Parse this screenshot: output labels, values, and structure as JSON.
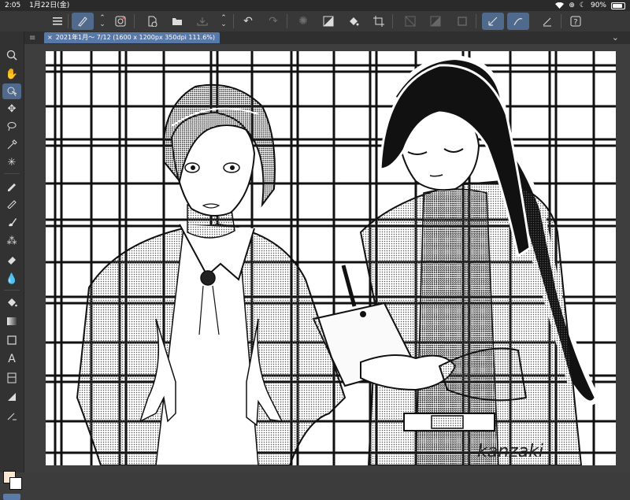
{
  "status_bar": {
    "time": "2:05",
    "date": "1月22日(金)",
    "battery": "90%",
    "battery_level": 0.9
  },
  "command_bar": {
    "menu_icon": "hamburger-menu-icon",
    "tools": [
      "drawing-select-icon",
      "swap-icon",
      "capture-icon",
      "new-canvas-icon",
      "open-folder-icon",
      "save-icon",
      "undo-icon",
      "redo-icon",
      "loading-spinner-icon",
      "fill-icon",
      "crop-icon",
      "transparency-icon",
      "snap-icon",
      "ruler-icon",
      "brush-settings-icon",
      "help-icon"
    ]
  },
  "document_tab": {
    "title": "2021年1月〜 7/12 (1600 x 1200px 350dpi 111.6%)"
  },
  "left_toolbar": {
    "tools": [
      "zoom-icon",
      "hand-icon",
      "object-select-icon",
      "move-icon",
      "lasso-icon",
      "eyedropper-icon",
      "auto-select-icon",
      "pen-icon",
      "pencil-icon",
      "brush-icon",
      "airbrush-icon",
      "eraser-icon",
      "blend-icon",
      "fill-bucket-icon",
      "gradient-icon",
      "shape-icon",
      "text-icon",
      "frame-icon",
      "ruler-tool-icon",
      "correction-icon"
    ],
    "main_color": "#fbe7cf",
    "sub_color": "#ffffff"
  },
  "artwork": {
    "signature": "kanzaki"
  },
  "colors": {
    "accent": "#4f6a8c",
    "tab_active": "#5878a8",
    "toolbar_bg": "#383838"
  }
}
